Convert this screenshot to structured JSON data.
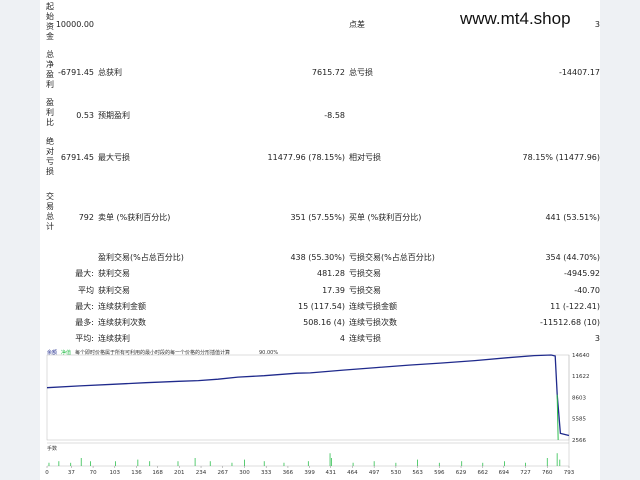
{
  "watermark": "www.mt4.shop",
  "report": {
    "initial_deposit": {
      "label": "起始资金",
      "value": "10000.00",
      "spread_label": "点差",
      "spread_value": "3"
    },
    "total_net_profit": {
      "label": "总净盈利",
      "value": "-6791.45",
      "gross_profit_label": "总获利",
      "gross_profit_value": "7615.72",
      "gross_loss_label": "总亏损",
      "gross_loss_value": "-14407.17"
    },
    "profit_factor": {
      "label": "盈利比",
      "value": "0.53",
      "expected_payoff_label": "预期盈利",
      "expected_payoff_value": "-8.58"
    },
    "absolute_drawdown": {
      "label": "绝对亏损",
      "value": "6791.45",
      "max_drawdown_label": "最大亏损",
      "max_drawdown_value": "11477.96 (78.15%)",
      "relative_drawdown_label": "相对亏损",
      "relative_drawdown_value": "78.15% (11477.96)"
    },
    "total_trades": {
      "label": "交易总计",
      "value": "792",
      "short_label": "卖单 (%获利百分比)",
      "short_value": "351 (57.55%)",
      "long_label": "买单 (%获利百分比)",
      "long_value": "441 (53.51%)"
    },
    "profit_trades": {
      "label": "盈利交易(%占总百分比)",
      "value": "438 (55.30%)",
      "loss_label": "亏损交易(%占总百分比)",
      "loss_value": "354 (44.70%)"
    },
    "largest": {
      "prefix": "最大:",
      "profit_label": "获利交易",
      "profit_value": "481.28",
      "loss_label": "亏损交易",
      "loss_value": "-4945.92"
    },
    "average": {
      "prefix": "平均",
      "profit_label": "获利交易",
      "profit_value": "17.39",
      "loss_label": "亏损交易",
      "loss_value": "-40.70"
    },
    "max_consecutive": {
      "prefix": "最大:",
      "wins_label": "连续获利金额",
      "wins_value": "15 (117.54)",
      "losses_label": "连续亏损金额",
      "losses_value": "11 (-122.41)"
    },
    "maximal_consecutive": {
      "prefix": "最多:",
      "profit_label": "连续获利次数",
      "profit_value": "508.16 (4)",
      "loss_label": "连续亏损次数",
      "loss_value": "-11512.68 (10)"
    },
    "avg_consecutive": {
      "prefix": "平均:",
      "wins_label": "连续获利",
      "wins_value": "4",
      "losses_label": "连续亏损",
      "losses_value": "3"
    }
  },
  "chart_data": {
    "type": "line",
    "title_parts": [
      "余额",
      "净值",
      "每个即时价格属于所有可利用的最小时段的每一个价格的分形插值计算",
      "90.00%"
    ],
    "balance_color": "#1f2a8c",
    "volume_color": "#2fbf4f",
    "equity_color": "#2fbf4f",
    "y_ticks": [
      14640,
      11622,
      8603,
      5585,
      2566
    ],
    "ylim": [
      2566,
      14640
    ],
    "x_ticks": [
      0,
      37,
      70,
      103,
      136,
      168,
      201,
      234,
      267,
      300,
      333,
      366,
      399,
      431,
      464,
      497,
      530,
      563,
      596,
      629,
      662,
      694,
      727,
      760,
      793
    ],
    "xlim": [
      0,
      793
    ],
    "balance": {
      "x": [
        0,
        50,
        100,
        150,
        200,
        230,
        260,
        290,
        330,
        380,
        400,
        450,
        500,
        550,
        600,
        650,
        700,
        740,
        766,
        772,
        775,
        780,
        793
      ],
      "y": [
        10000,
        10250,
        10480,
        10700,
        10900,
        11000,
        11200,
        11500,
        11700,
        12050,
        12100,
        12500,
        12850,
        13200,
        13500,
        13850,
        14250,
        14550,
        14640,
        14500,
        9000,
        3500,
        3208
      ]
    },
    "volume_label": "手数",
    "volume": {
      "x": [
        3,
        18,
        36,
        52,
        66,
        104,
        138,
        156,
        199,
        225,
        248,
        281,
        300,
        330,
        360,
        397,
        430,
        432,
        465,
        497,
        530,
        563,
        596,
        630,
        662,
        695,
        727,
        760,
        775,
        779
      ],
      "y": [
        0.2,
        0.3,
        0.2,
        0.5,
        0.3,
        0.3,
        0.4,
        0.3,
        0.3,
        0.5,
        0.3,
        0.2,
        0.4,
        0.3,
        0.2,
        0.3,
        0.8,
        0.5,
        0.2,
        0.3,
        0.2,
        0.4,
        0.2,
        0.3,
        0.2,
        0.3,
        0.2,
        0.5,
        0.8,
        0.4
      ]
    }
  }
}
